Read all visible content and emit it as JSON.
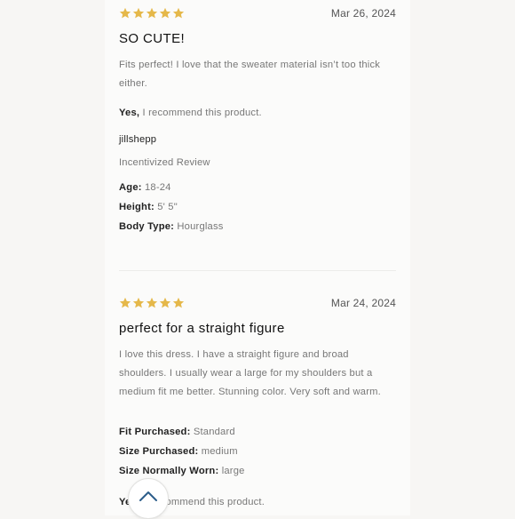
{
  "colors": {
    "star": "#e5b84a",
    "accent": "#2c5d8a"
  },
  "reviews": [
    {
      "rating": 5,
      "date": "Mar 26, 2024",
      "title": "SO CUTE!",
      "body": "Fits perfect! I love that the sweater material isn’t too thick either.",
      "recommend_label": "Yes,",
      "recommend_text": " I recommend this product.",
      "username": "jillshepp",
      "badge": "Incentivized Review",
      "attributes": [
        {
          "label": "Age:",
          "value": " 18-24"
        },
        {
          "label": "Height:",
          "value": " 5' 5\""
        },
        {
          "label": "Body Type:",
          "value": " Hourglass"
        }
      ]
    },
    {
      "rating": 5,
      "date": "Mar 24, 2024",
      "title": "perfect for a straight figure",
      "body": "I love this dress. I have a straight figure and broad shoulders. I usually wear a large for my shoulders but a medium fit me better. Stunning color. Very soft and warm.",
      "attributes": [
        {
          "label": "Fit Purchased:",
          "value": " Standard"
        },
        {
          "label": "Size Purchased:",
          "value": " medium"
        },
        {
          "label": "Size Normally Worn:",
          "value": " large"
        }
      ],
      "recommend_label": "Yes,",
      "recommend_text": " I recommend this product.",
      "recommend_visible_text": "Ye",
      "recommend_visible_tail": "ommend this product."
    }
  ],
  "scroll_top": {
    "icon": "chevron-up-icon"
  }
}
